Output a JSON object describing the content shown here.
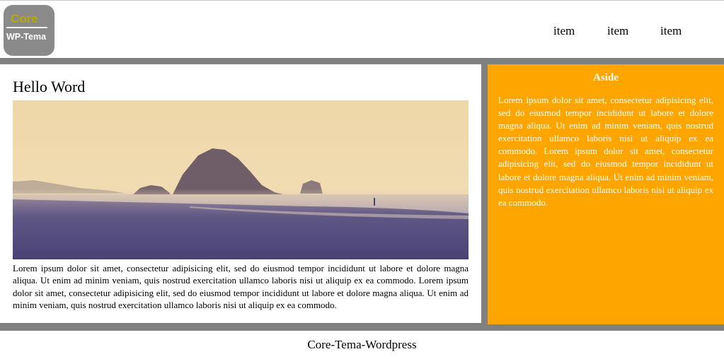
{
  "logo": {
    "line1": "Core",
    "line2": "WP-Tema"
  },
  "nav": {
    "items": [
      {
        "label": "item"
      },
      {
        "label": "item"
      },
      {
        "label": "item"
      }
    ]
  },
  "main": {
    "title": "Hello Word",
    "text": "Lorem ipsum dolor sit amet, consectetur adipisicing elit, sed do eiusmod tempor incididunt ut labore et dolore magna aliqua. Ut enim ad minim veniam, quis nostrud exercitation ullamco laboris nisi ut aliquip ex ea commodo. Lorem ipsum dolor sit amet, consectetur adipisicing elit, sed do eiusmod tempor incididunt ut labore et dolore magna aliqua. Ut enim ad minim veniam, quis nostrud exercitation ullamco laboris nisi ut aliquip ex ea commodo."
  },
  "aside": {
    "title": "Aside",
    "text": "Lorem ipsum dolor sit amet, consectetur adipisicing elit, sed do eiusmod tempor incididunt ut labore et dolore magna aliqua. Ut enim ad minim veniam, quis nostrud exercitation ullamco laboris nisi ut aliquip ex ea commodo. Lorem ipsum dolor sit amet, consectetur adipisicing elit, sed do eiusmod tempor incididunt ut labore et dolore magna aliqua. Ut enim ad minim veniam, quis nostrud exercitation ullamco laboris nisi ut aliquip ex ea commodo."
  },
  "footer": {
    "text": "Core-Tema-Wordpress"
  },
  "colors": {
    "accent": "#ffa500",
    "band": "#808080",
    "logo_bg": "#8a8a8a",
    "logo_core": "#b8a800"
  }
}
